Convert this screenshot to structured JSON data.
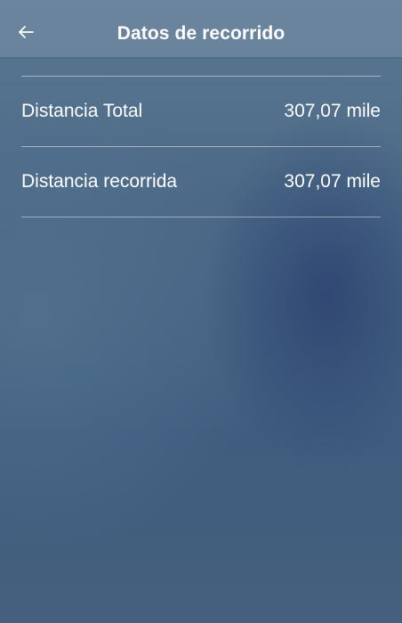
{
  "header": {
    "title": "Datos de recorrido",
    "back_icon": "arrow-left-icon"
  },
  "rows": [
    {
      "label": "Distancia Total",
      "value": "307,07 mile"
    },
    {
      "label": "Distancia recorrida",
      "value": "307,07 mile"
    }
  ],
  "colors": {
    "text": "#ffffff",
    "divider": "rgba(255,255,255,0.45)",
    "background_top": "#5b7892",
    "background_bottom": "#45607e"
  }
}
